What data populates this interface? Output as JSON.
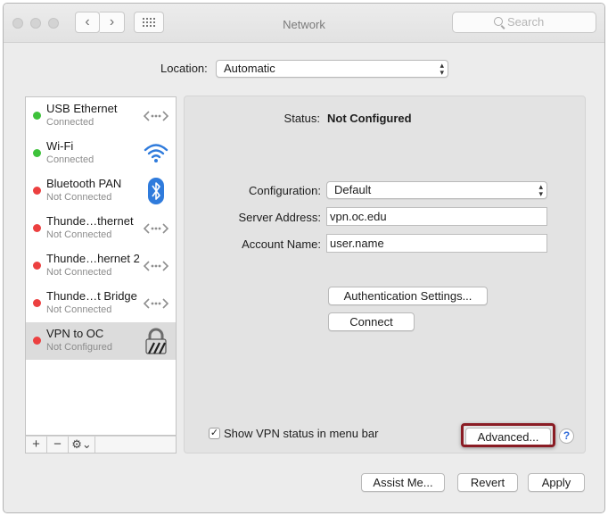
{
  "window": {
    "title": "Network"
  },
  "search": {
    "placeholder": "Search"
  },
  "location": {
    "label": "Location:",
    "value": "Automatic"
  },
  "services": [
    {
      "name": "USB Ethernet",
      "status": "Connected",
      "status_color": "#3ec23b",
      "icon": "ethernet-icon"
    },
    {
      "name": "Wi-Fi",
      "status": "Connected",
      "status_color": "#3ec23b",
      "icon": "wifi-icon"
    },
    {
      "name": "Bluetooth PAN",
      "status": "Not Connected",
      "status_color": "#ec4040",
      "icon": "bluetooth-icon"
    },
    {
      "name": "Thunde…thernet",
      "status": "Not Connected",
      "status_color": "#ec4040",
      "icon": "ethernet-icon"
    },
    {
      "name": "Thunde…hernet 2",
      "status": "Not Connected",
      "status_color": "#ec4040",
      "icon": "ethernet-icon"
    },
    {
      "name": "Thunde…t Bridge",
      "status": "Not Connected",
      "status_color": "#ec4040",
      "icon": "ethernet-icon"
    },
    {
      "name": "VPN to OC",
      "status": "Not Configured",
      "status_color": "#ec4040",
      "icon": "vpn-lock-icon",
      "selected": true
    }
  ],
  "sidebar_tools": {
    "add": "+",
    "remove": "−",
    "gear": "⚙︎⌄"
  },
  "detail": {
    "status_label": "Status:",
    "status_value": "Not Configured",
    "configuration_label": "Configuration:",
    "configuration_value": "Default",
    "server_label": "Server Address:",
    "server_value": "vpn.oc.edu",
    "account_label": "Account Name:",
    "account_value": "user.name",
    "auth_button": "Authentication Settings...",
    "connect_button": "Connect",
    "show_status_label": "Show VPN status in menu bar",
    "show_status_checked": true,
    "advanced_button": "Advanced...",
    "help": "?"
  },
  "footer": {
    "assist": "Assist Me...",
    "revert": "Revert",
    "apply": "Apply"
  },
  "colors": {
    "highlight": "#8a1c24",
    "help_blue": "#2f6ad9"
  }
}
